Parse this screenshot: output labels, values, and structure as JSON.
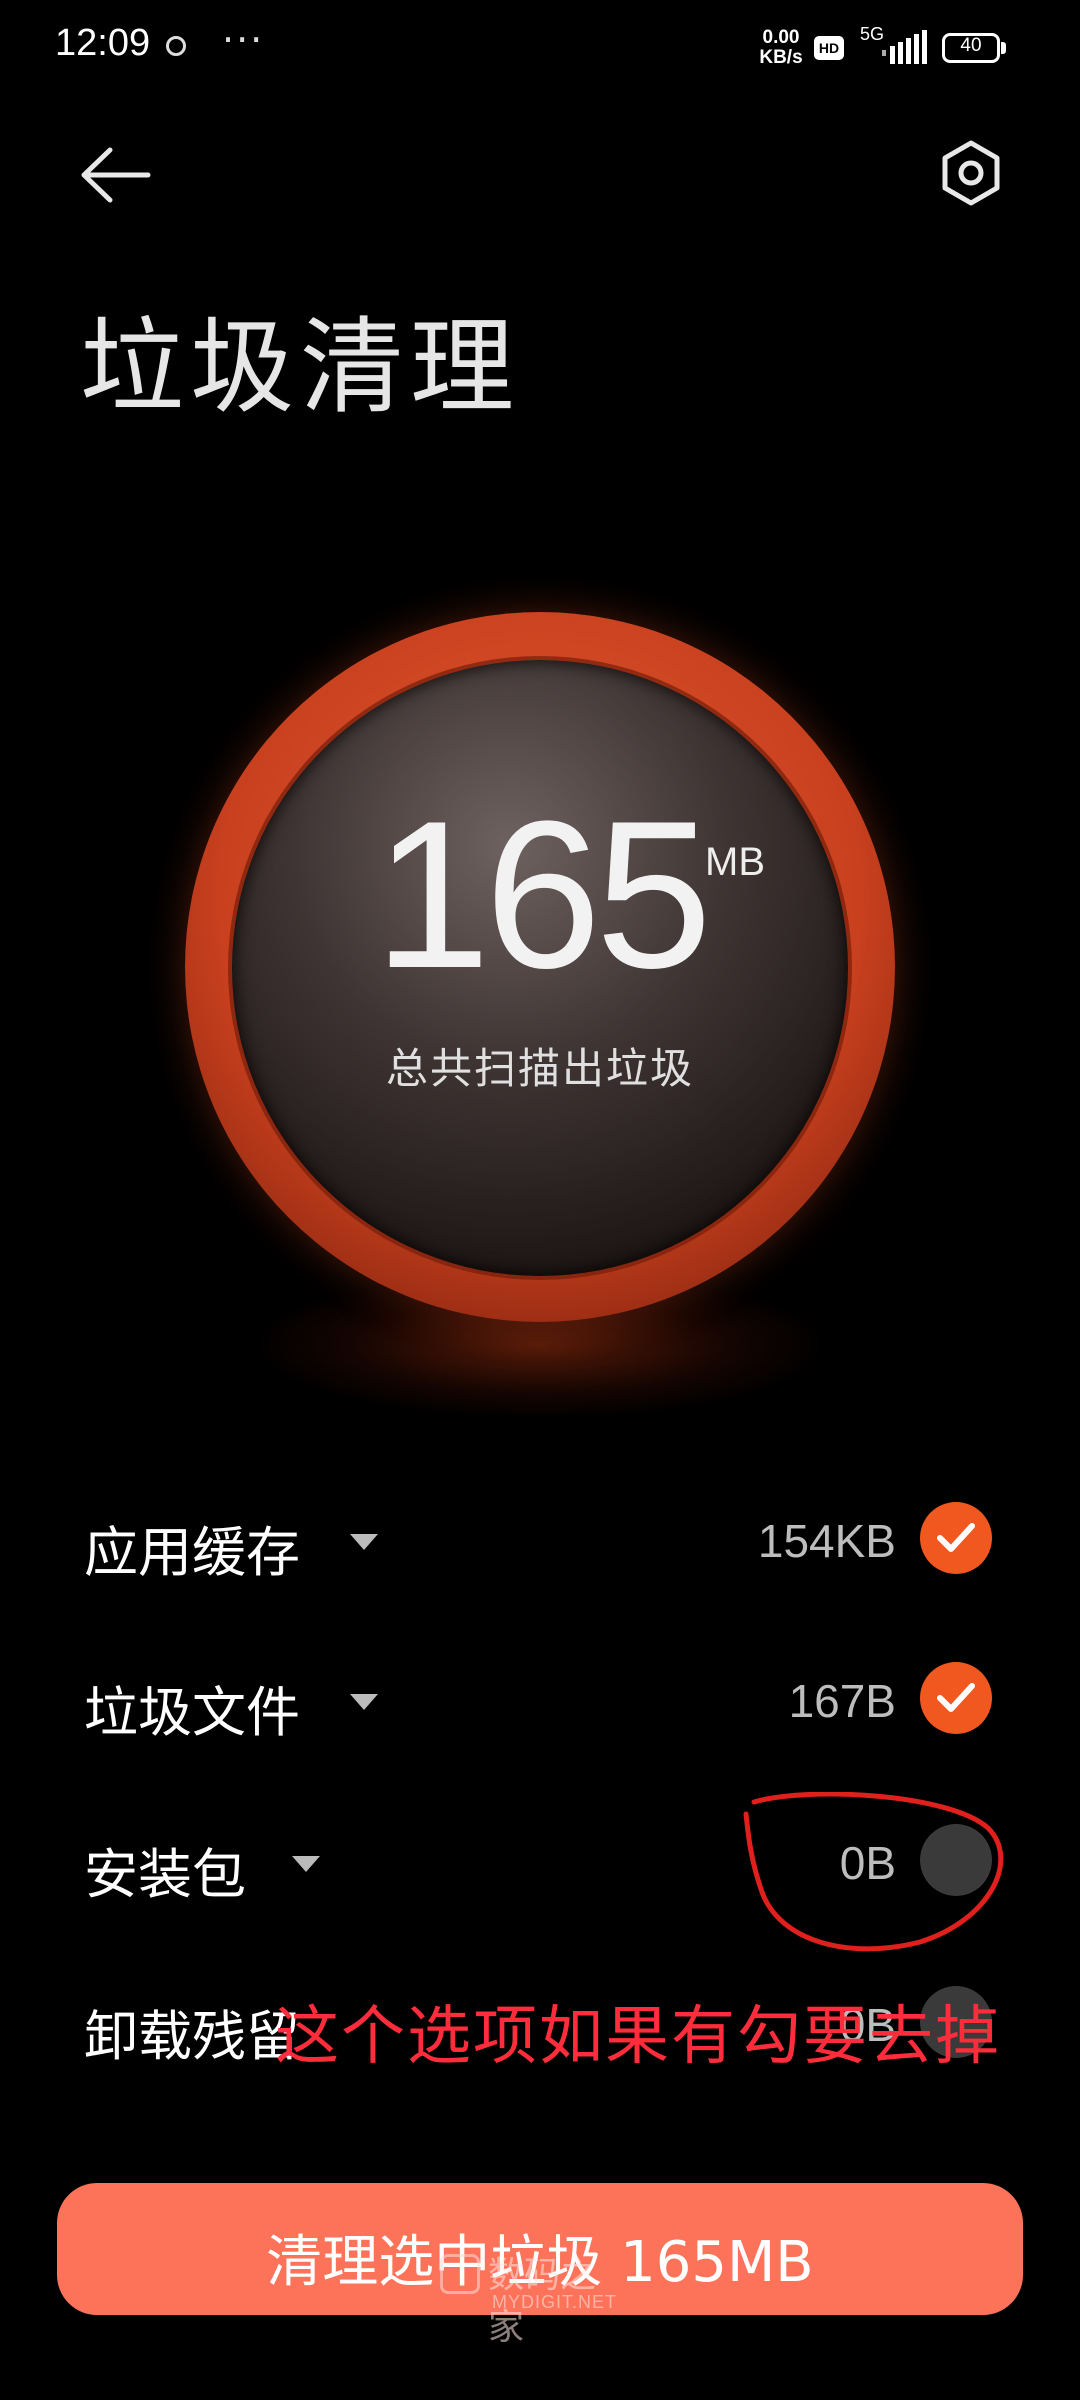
{
  "status_bar": {
    "time": "12:09",
    "more": "···",
    "net_speed_value": "0.00",
    "net_speed_unit": "KB/s",
    "hd_badge": "HD",
    "network_type": "5G",
    "battery_level": "40"
  },
  "header": {
    "back_icon": "arrow-left-icon",
    "settings_icon": "hexagon-gear-icon",
    "title": "垃圾清理"
  },
  "summary": {
    "total_value": "165",
    "total_unit": "MB",
    "total_label": "总共扫描出垃圾",
    "ring_color": "#e0502a"
  },
  "categories": [
    {
      "label": "应用缓存",
      "size": "154KB",
      "checked": true
    },
    {
      "label": "垃圾文件",
      "size": "167B",
      "checked": true
    },
    {
      "label": "安装包",
      "size": "0B",
      "checked": false
    },
    {
      "label": "卸载残留",
      "size": "0B",
      "checked": false
    }
  ],
  "annotation": {
    "text": "这个选项如果有勾要去掉",
    "color": "#ff2d3c"
  },
  "action": {
    "clean_label": "清理选中垃圾 165MB",
    "button_color": "#fd735a",
    "check_color": "#f0581f"
  },
  "watermark": {
    "chinese": "数码之家",
    "english": "MYDIGIT.NET"
  }
}
